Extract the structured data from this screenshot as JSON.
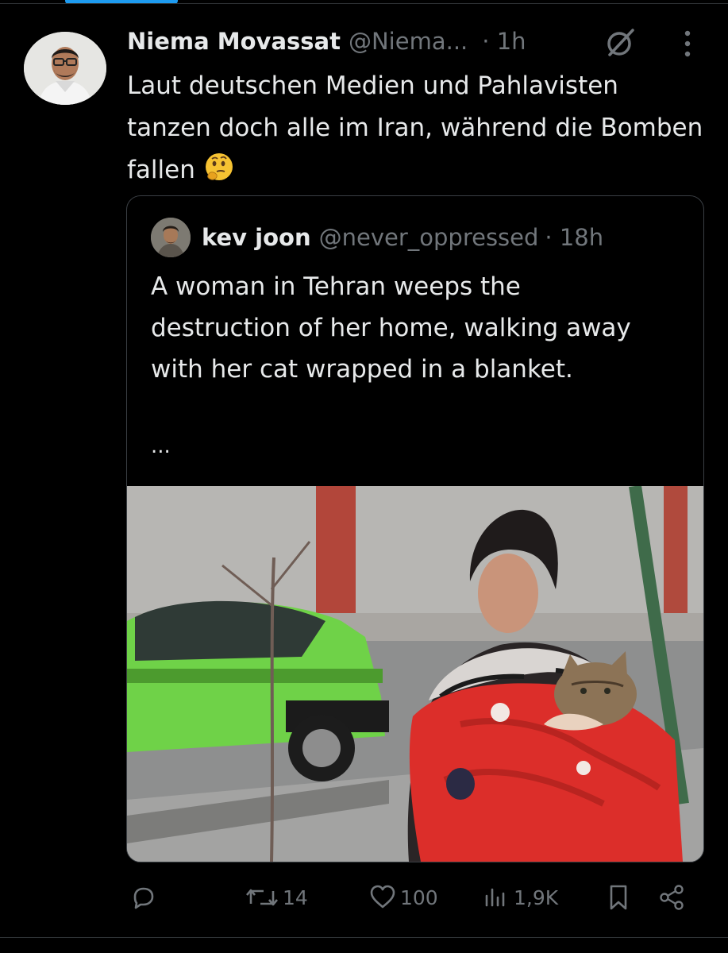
{
  "post": {
    "author_name": "Niema Movassat",
    "author_handle": "@Niema...",
    "time": "· 1h",
    "text": "Laut deutschen Medien und Pahlavisten tanzen doch alle im Iran, während die Bomben fallen",
    "emoji": "thinking-face"
  },
  "quote": {
    "author_name": "kev joon",
    "author_handle": "@never_oppressed",
    "time": "· 18h",
    "text": "A woman in Tehran weeps the destruction of her home, walking away with her cat wrapped in a blanket.",
    "more": "...",
    "media": "photo"
  },
  "actions": {
    "reply_count": "",
    "repost_count": "14",
    "like_count": "100",
    "views_count": "1,9K"
  },
  "icons": {
    "grok": "grok-icon",
    "more": "more-icon",
    "reply": "reply-icon",
    "repost": "repost-icon",
    "like": "heart-icon",
    "views": "views-icon",
    "bookmark": "bookmark-icon",
    "share": "share-icon"
  },
  "colors": {
    "background": "#000000",
    "text": "#e7e9ea",
    "muted": "#71767b",
    "accent": "#1d9bf0",
    "border": "#3a3f44"
  }
}
